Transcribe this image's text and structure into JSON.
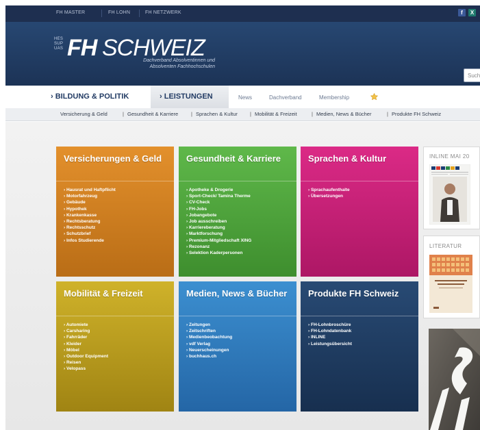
{
  "topbar": {
    "links": [
      "FH MASTER",
      "FH LOHN",
      "FH NETZWERK"
    ],
    "social": [
      {
        "name": "facebook",
        "glyph": "f",
        "color": "#3b5998"
      },
      {
        "name": "xing",
        "glyph": "X",
        "color": "#1f7a6e"
      }
    ]
  },
  "header": {
    "logo_small": [
      "HES",
      "SUP",
      "UAS"
    ],
    "logo_fh": "FH",
    "logo_schweiz": "SCHWEIZ",
    "tagline_1": "Dachverband Absolventinnen und",
    "tagline_2": "Absolventen Fachhochschulen",
    "search_placeholder": "Suche"
  },
  "mainnav": {
    "bildung": "› BILDUNG & POLITIK",
    "leistungen": "› LEISTUNGEN",
    "news": "News",
    "dachverband": "Dachverband",
    "membership": "Membership"
  },
  "subnav": [
    "Versicherung & Geld",
    "Gesundheit & Karriere",
    "Sprachen & Kultur",
    "Mobilität & Freizeit",
    "Medien, News & Bücher",
    "Produkte FH Schweiz"
  ],
  "tiles": [
    {
      "title": "Versicherungen & Geld",
      "color_top": "#e3902c",
      "color_bottom": "#b96d16",
      "items": [
        "› Hausrat und Haftpflicht",
        "› Motorfahrzeug",
        "› Gebäude",
        "› Hypothek",
        "› Krankenkasse",
        "› Rechtsberatung",
        "› Rechtsschutz",
        "› Schutzbrief",
        "› Infos Studierende"
      ]
    },
    {
      "title": "Gesundheit & Karriere",
      "color_top": "#5fb84a",
      "color_bottom": "#3e8e2e",
      "items": [
        "› Apotheke & Drogerie",
        "› Sport-Check/ Tamina Therme",
        "› CV-Check",
        "› FH-Jobs",
        "› Jobangebote",
        "› Job ausschreiben",
        "› Karriereberatung",
        "› Marktforschung",
        "› Premium-Mitgliedschaft XING",
        "› Rezonanz",
        "› Selektion Kaderpersonen"
      ]
    },
    {
      "title": "Sprachen & Kultur",
      "color_top": "#db2a86",
      "color_bottom": "#ad1765",
      "items": [
        "› Sprachaufenthalte",
        "› Übersetzungen"
      ]
    },
    {
      "title": "Mobilität & Freizeit",
      "color_top": "#cfb22a",
      "color_bottom": "#a08413",
      "items": [
        "› Automiete",
        "› Carsharing",
        "› Fahrräder",
        "› Kleider",
        "› Möbel",
        "› Outdoor Equipment",
        "› Reisen",
        "› Velopass"
      ]
    },
    {
      "title": "Medien, News & Bücher",
      "color_top": "#3c8fd0",
      "color_bottom": "#2466a6",
      "items": [
        "› Zeitungen",
        "› Zeitschriften",
        "› Medienbeobachtung",
        "› vdf Verlag",
        "› Neuerscheinungen",
        "› buchhaus.ch"
      ]
    },
    {
      "title": "Produkte FH Schweiz",
      "color_top": "#284a74",
      "color_bottom": "#172f4f",
      "items": [
        "› FH-Lohnbroschüre",
        "› FH-Lohndatenbank",
        "› INLINE",
        "› Leistungsübersicht"
      ]
    }
  ],
  "sidebar": {
    "inline_title": "INLINE MAI 20",
    "literatur_title": "LITERATUR"
  }
}
